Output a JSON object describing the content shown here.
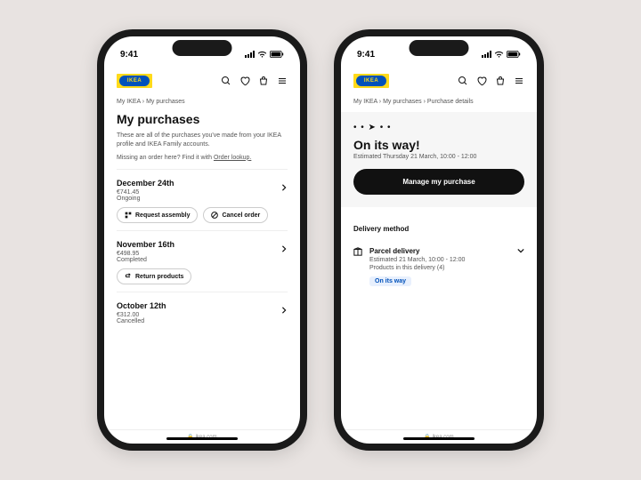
{
  "status_bar": {
    "time": "9:41"
  },
  "logo_text": "IKEA",
  "footer_domain": "ikea.com",
  "left": {
    "breadcrumb": [
      "My IKEA",
      "My purchases"
    ],
    "title": "My purchases",
    "description": "These are all of the purchases you've made from your IKEA profile and IKEA Family accounts.",
    "lookup_prefix": "Missing an order here? Find it with ",
    "lookup_link": "Order lookup.",
    "purchases": [
      {
        "date": "December 24th",
        "amount": "€741.45",
        "status": "Ongoing",
        "actions": [
          {
            "icon": "assembly",
            "label": "Request assembly"
          },
          {
            "icon": "cancel",
            "label": "Cancel order"
          }
        ]
      },
      {
        "date": "November 16th",
        "amount": "€498.95",
        "status": "Completed",
        "actions": [
          {
            "icon": "return",
            "label": "Return products"
          }
        ]
      },
      {
        "date": "October 12th",
        "amount": "€312.00",
        "status": "Cancelled",
        "actions": []
      }
    ]
  },
  "right": {
    "breadcrumb": [
      "My IKEA",
      "My purchases",
      "Purchase details"
    ],
    "status_title": "On its way!",
    "status_eta": "Estimated Thursday 21 March, 10:00 - 12:00",
    "manage_button": "Manage my purchase",
    "delivery_heading": "Delivery method",
    "delivery": {
      "title": "Parcel delivery",
      "eta": "Estimated 21 March, 10:00 - 12:00",
      "product_count": "Products in this delivery (4)",
      "badge": "On its way"
    }
  }
}
